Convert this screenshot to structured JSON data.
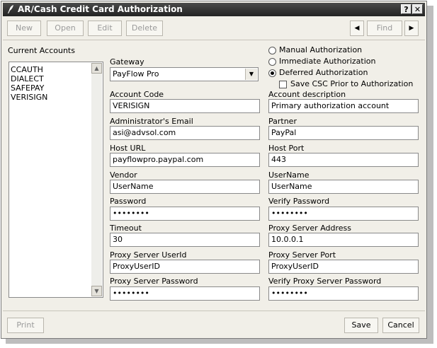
{
  "window": {
    "title": "AR/Cash Credit Card Authorization",
    "help_btn": "?",
    "close_btn": "✕",
    "app_icon": "feather-icon"
  },
  "toolbar": {
    "new": "New",
    "open": "Open",
    "edit": "Edit",
    "delete": "Delete",
    "prev": "◀",
    "find": "Find",
    "next": "▶"
  },
  "accounts": {
    "label": "Current Accounts",
    "items": [
      "CCAUTH",
      "DIALECT",
      "SAFEPAY",
      "VERISIGN"
    ]
  },
  "gateway": {
    "label": "Gateway",
    "value": "PayFlow Pro"
  },
  "auth": {
    "manual": "Manual Authorization",
    "immediate": "Immediate Authorization",
    "deferred": "Deferred Authorization",
    "selected": "deferred",
    "save_csc": "Save CSC Prior to Authorization",
    "save_csc_checked": false
  },
  "fields": {
    "account_code": {
      "label": "Account Code",
      "value": "VERISIGN"
    },
    "account_desc": {
      "label": "Account description",
      "value": "Primary authorization account"
    },
    "admin_email": {
      "label": "Administrator's Email",
      "value": "asi@advsol.com"
    },
    "partner": {
      "label": "Partner",
      "value": "PayPal"
    },
    "host_url": {
      "label": "Host URL",
      "value": "payflowpro.paypal.com"
    },
    "host_port": {
      "label": "Host Port",
      "value": "443"
    },
    "vendor": {
      "label": "Vendor",
      "value": "UserName"
    },
    "username": {
      "label": "UserName",
      "value": "UserName"
    },
    "password": {
      "label": "Password",
      "value": "••••••••"
    },
    "verify_password": {
      "label": "Verify Password",
      "value": "••••••••"
    },
    "timeout": {
      "label": "Timeout",
      "value": "30"
    },
    "proxy_address": {
      "label": "Proxy Server Address",
      "value": "10.0.0.1"
    },
    "proxy_userid": {
      "label": "Proxy Server UserId",
      "value": "ProxyUserID"
    },
    "proxy_port": {
      "label": "Proxy Server Port",
      "value": "ProxyUserID"
    },
    "proxy_password": {
      "label": "Proxy Server Password",
      "value": "••••••••"
    },
    "verify_proxy_password": {
      "label": "Verify Proxy Server Password",
      "value": "••••••••"
    }
  },
  "footer": {
    "print": "Print",
    "save": "Save",
    "cancel": "Cancel"
  }
}
